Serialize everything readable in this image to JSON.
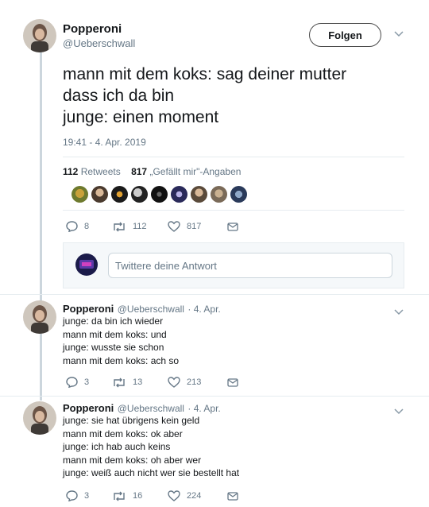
{
  "main_tweet": {
    "name": "Popperoni",
    "handle": "@Ueberschwall",
    "follow_label": "Folgen",
    "text_lines": [
      "mann mit dem koks: sag deiner mutter",
      "dass ich da bin",
      "junge: einen moment"
    ],
    "timestamp": "19:41 - 4. Apr. 2019",
    "retweets_count": "112",
    "retweets_label": "Retweets",
    "likes_count": "817",
    "likes_label": "„Gefällt mir\"-Angaben",
    "actions": {
      "replies": "8",
      "retweets": "112",
      "likes": "817"
    }
  },
  "reply_box": {
    "placeholder": "Twittere deine Antwort"
  },
  "replies": [
    {
      "name": "Popperoni",
      "handle": "@Ueberschwall",
      "date": "· 4. Apr.",
      "lines": [
        "junge: da bin ich wieder",
        "mann mit dem koks: und",
        "junge: wusste sie schon",
        "mann mit dem koks: ach so"
      ],
      "actions": {
        "replies": "3",
        "retweets": "13",
        "likes": "213"
      }
    },
    {
      "name": "Popperoni",
      "handle": "@Ueberschwall",
      "date": "· 4. Apr.",
      "lines": [
        "junge: sie hat übrigens kein geld",
        "mann mit dem koks: ok aber",
        "junge: ich hab auch keins",
        "mann mit dem koks: oh aber wer",
        "junge: weiß auch nicht wer sie bestellt hat"
      ],
      "actions": {
        "replies": "3",
        "retweets": "16",
        "likes": "224"
      }
    }
  ],
  "colors": {
    "text": "#14171a",
    "secondary": "#657786",
    "border": "#e6ecf0",
    "thread_line": "#ccd6dd"
  }
}
